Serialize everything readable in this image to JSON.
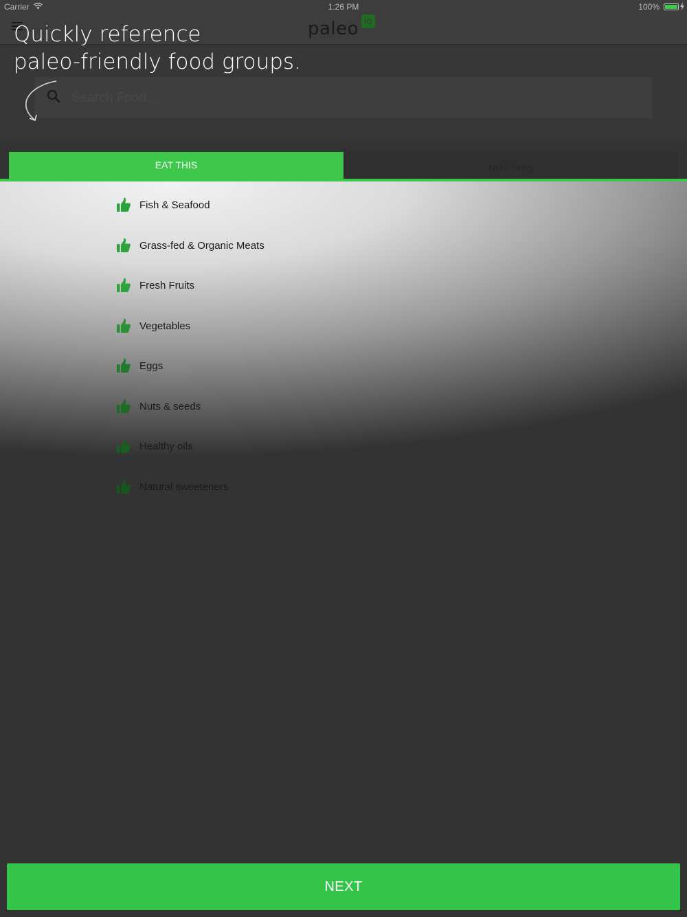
{
  "status_bar": {
    "carrier": "Carrier",
    "time": "1:26 PM",
    "battery": "100%"
  },
  "nav": {
    "logo_text": "paleo",
    "logo_badge": "io"
  },
  "tutorial": {
    "line1": "Quickly reference",
    "line2": "paleo-friendly food groups."
  },
  "search": {
    "placeholder": "Search Food..."
  },
  "tabs": [
    {
      "label": "EAT THIS",
      "active": true
    },
    {
      "label": "NOT THIS",
      "active": false
    }
  ],
  "food_groups": [
    {
      "label": "Fish & Seafood",
      "icon": "thumbs-up-icon"
    },
    {
      "label": "Grass-fed & Organic Meats",
      "icon": "thumbs-up-icon"
    },
    {
      "label": "Fresh Fruits",
      "icon": "thumbs-up-icon"
    },
    {
      "label": "Vegetables",
      "icon": "thumbs-up-icon"
    },
    {
      "label": "Eggs",
      "icon": "thumbs-up-icon"
    },
    {
      "label": "Nuts & seeds",
      "icon": "thumbs-up-icon"
    },
    {
      "label": "Healthy oils",
      "icon": "thumbs-up-icon"
    },
    {
      "label": "Natural sweeteners",
      "icon": "thumbs-up-icon"
    }
  ],
  "next_button": {
    "label": "NEXT"
  },
  "colors": {
    "accent_green": "#3ec84b",
    "icon_green": "#2fa23d",
    "background_dark": "#333333"
  }
}
